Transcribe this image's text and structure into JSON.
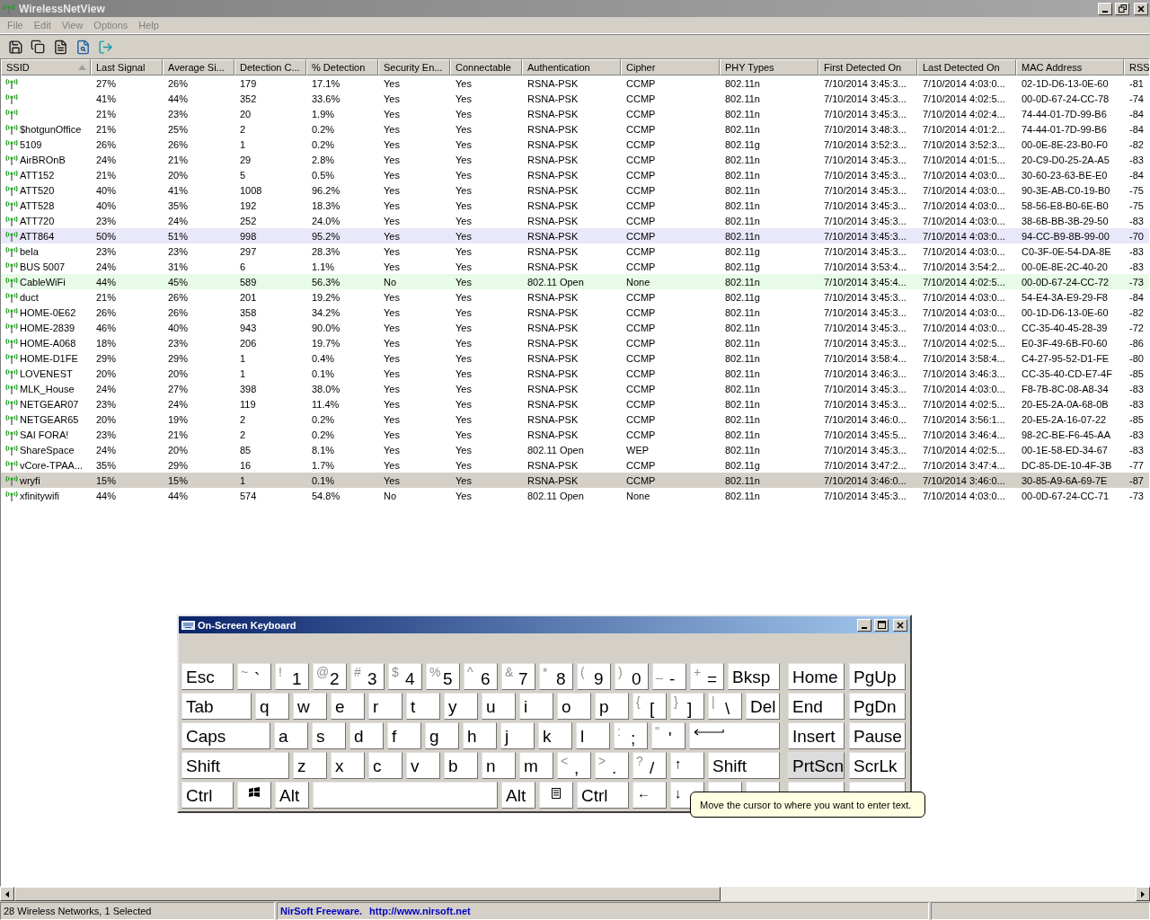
{
  "window": {
    "title": "WirelessNetView"
  },
  "menu": [
    "File",
    "Edit",
    "View",
    "Options",
    "Help"
  ],
  "toolbar": [
    {
      "kind": "save"
    },
    {
      "kind": "copy"
    },
    {
      "kind": "properties"
    },
    {
      "kind": "find"
    },
    {
      "kind": "exit"
    }
  ],
  "table": {
    "columns": [
      {
        "label": "SSID",
        "sorted": true
      },
      {
        "label": "Last Signal",
        "sorted": false
      },
      {
        "label": "Average Si...",
        "sorted": false
      },
      {
        "label": "Detection C...",
        "sorted": false
      },
      {
        "label": "% Detection",
        "sorted": false
      },
      {
        "label": "Security En...",
        "sorted": false
      },
      {
        "label": "Connectable",
        "sorted": false
      },
      {
        "label": "Authentication",
        "sorted": false
      },
      {
        "label": "Cipher",
        "sorted": false
      },
      {
        "label": "PHY Types",
        "sorted": false
      },
      {
        "label": "First Detected On",
        "sorted": false
      },
      {
        "label": "Last Detected On",
        "sorted": false
      },
      {
        "label": "MAC Address",
        "sorted": false
      },
      {
        "label": "RSS",
        "sorted": false
      }
    ],
    "rows": [
      {
        "values": [
          "27%",
          "26%",
          "179",
          "17.1%",
          "Yes",
          "Yes",
          "RSNA-PSK",
          "CCMP",
          "802.11n",
          "7/10/2014 3:45:3...",
          "7/10/2014 4:03:0...",
          "02-1D-D6-13-0E-60",
          "-81"
        ],
        "color": "#ffffff",
        "selected": false
      },
      {
        "values": [
          "41%",
          "44%",
          "352",
          "33.6%",
          "Yes",
          "Yes",
          "RSNA-PSK",
          "CCMP",
          "802.11n",
          "7/10/2014 3:45:3...",
          "7/10/2014 4:02:5...",
          "00-0D-67-24-CC-78",
          "-74"
        ],
        "color": "#ffffff",
        "selected": false
      },
      {
        "values": [
          "21%",
          "23%",
          "20",
          "1.9%",
          "Yes",
          "Yes",
          "RSNA-PSK",
          "CCMP",
          "802.11n",
          "7/10/2014 3:45:3...",
          "7/10/2014 4:02:4...",
          "74-44-01-7D-99-B6",
          "-84"
        ],
        "color": "#ffffff",
        "selected": false
      },
      {
        "ssid": "$hotgunOffice",
        "values": [
          "21%",
          "25%",
          "2",
          "0.2%",
          "Yes",
          "Yes",
          "RSNA-PSK",
          "CCMP",
          "802.11n",
          "7/10/2014 3:48:3...",
          "7/10/2014 4:01:2...",
          "74-44-01-7D-99-B6",
          "-84"
        ],
        "color": "#ffffff",
        "selected": false
      },
      {
        "ssid": "5109",
        "values": [
          "26%",
          "26%",
          "1",
          "0.2%",
          "Yes",
          "Yes",
          "RSNA-PSK",
          "CCMP",
          "802.11g",
          "7/10/2014 3:52:3...",
          "7/10/2014 3:52:3...",
          "00-0E-8E-23-B0-F0",
          "-82"
        ],
        "color": "#ffffff",
        "selected": false
      },
      {
        "ssid": "AirBROnB",
        "values": [
          "24%",
          "21%",
          "29",
          "2.8%",
          "Yes",
          "Yes",
          "RSNA-PSK",
          "CCMP",
          "802.11n",
          "7/10/2014 3:45:3...",
          "7/10/2014 4:01:5...",
          "20-C9-D0-25-2A-A5",
          "-83"
        ],
        "color": "#ffffff",
        "selected": false
      },
      {
        "ssid": "ATT152",
        "values": [
          "21%",
          "20%",
          "5",
          "0.5%",
          "Yes",
          "Yes",
          "RSNA-PSK",
          "CCMP",
          "802.11n",
          "7/10/2014 3:45:3...",
          "7/10/2014 4:03:0...",
          "30-60-23-63-BE-E0",
          "-84"
        ],
        "color": "#ffffff",
        "selected": false
      },
      {
        "ssid": "ATT520",
        "values": [
          "40%",
          "41%",
          "1008",
          "96.2%",
          "Yes",
          "Yes",
          "RSNA-PSK",
          "CCMP",
          "802.11n",
          "7/10/2014 3:45:3...",
          "7/10/2014 4:03:0...",
          "90-3E-AB-C0-19-B0",
          "-75"
        ],
        "color": "#ffffff",
        "selected": false
      },
      {
        "ssid": "ATT528",
        "values": [
          "40%",
          "35%",
          "192",
          "18.3%",
          "Yes",
          "Yes",
          "RSNA-PSK",
          "CCMP",
          "802.11n",
          "7/10/2014 3:45:3...",
          "7/10/2014 4:03:0...",
          "58-56-E8-B0-6E-B0",
          "-75"
        ],
        "color": "#ffffff",
        "selected": false
      },
      {
        "ssid": "ATT720",
        "values": [
          "23%",
          "24%",
          "252",
          "24.0%",
          "Yes",
          "Yes",
          "RSNA-PSK",
          "CCMP",
          "802.11n",
          "7/10/2014 3:45:3...",
          "7/10/2014 4:03:0...",
          "38-6B-BB-3B-29-50",
          "-83"
        ],
        "color": "#ffffff",
        "selected": false
      },
      {
        "ssid": "ATT864",
        "values": [
          "50%",
          "51%",
          "998",
          "95.2%",
          "Yes",
          "Yes",
          "RSNA-PSK",
          "CCMP",
          "802.11n",
          "7/10/2014 3:45:3...",
          "7/10/2014 4:03:0...",
          "94-CC-B9-8B-99-00",
          "-70"
        ],
        "color": "#e8e8fa",
        "selected": false
      },
      {
        "ssid": "bela",
        "values": [
          "23%",
          "23%",
          "297",
          "28.3%",
          "Yes",
          "Yes",
          "RSNA-PSK",
          "CCMP",
          "802.11g",
          "7/10/2014 3:45:3...",
          "7/10/2014 4:03:0...",
          "C0-3F-0E-54-DA-8E",
          "-83"
        ],
        "color": "#ffffff",
        "selected": false
      },
      {
        "ssid": "BUS 5007",
        "values": [
          "24%",
          "31%",
          "6",
          "1.1%",
          "Yes",
          "Yes",
          "RSNA-PSK",
          "CCMP",
          "802.11g",
          "7/10/2014 3:53:4...",
          "7/10/2014 3:54:2...",
          "00-0E-8E-2C-40-20",
          "-83"
        ],
        "color": "#ffffff",
        "selected": false
      },
      {
        "ssid": "CableWiFi",
        "values": [
          "44%",
          "45%",
          "589",
          "56.3%",
          "No",
          "Yes",
          "802.11 Open",
          "None",
          "802.11n",
          "7/10/2014 3:45:4...",
          "7/10/2014 4:02:5...",
          "00-0D-67-24-CC-72",
          "-73"
        ],
        "color": "#e8fae8",
        "selected": false
      },
      {
        "ssid": "duct",
        "values": [
          "21%",
          "26%",
          "201",
          "19.2%",
          "Yes",
          "Yes",
          "RSNA-PSK",
          "CCMP",
          "802.11g",
          "7/10/2014 3:45:3...",
          "7/10/2014 4:03:0...",
          "54-E4-3A-E9-29-F8",
          "-84"
        ],
        "color": "#ffffff",
        "selected": false
      },
      {
        "ssid": "HOME-0E62",
        "values": [
          "26%",
          "26%",
          "358",
          "34.2%",
          "Yes",
          "Yes",
          "RSNA-PSK",
          "CCMP",
          "802.11n",
          "7/10/2014 3:45:3...",
          "7/10/2014 4:03:0...",
          "00-1D-D6-13-0E-60",
          "-82"
        ],
        "color": "#ffffff",
        "selected": false
      },
      {
        "ssid": "HOME-2839",
        "values": [
          "46%",
          "40%",
          "943",
          "90.0%",
          "Yes",
          "Yes",
          "RSNA-PSK",
          "CCMP",
          "802.11n",
          "7/10/2014 3:45:3...",
          "7/10/2014 4:03:0...",
          "CC-35-40-45-28-39",
          "-72"
        ],
        "color": "#ffffff",
        "selected": false
      },
      {
        "ssid": "HOME-A068",
        "values": [
          "18%",
          "23%",
          "206",
          "19.7%",
          "Yes",
          "Yes",
          "RSNA-PSK",
          "CCMP",
          "802.11n",
          "7/10/2014 3:45:3...",
          "7/10/2014 4:02:5...",
          "E0-3F-49-6B-F0-60",
          "-86"
        ],
        "color": "#ffffff",
        "selected": false
      },
      {
        "ssid": "HOME-D1FE",
        "values": [
          "29%",
          "29%",
          "1",
          "0.4%",
          "Yes",
          "Yes",
          "RSNA-PSK",
          "CCMP",
          "802.11n",
          "7/10/2014 3:58:4...",
          "7/10/2014 3:58:4...",
          "C4-27-95-52-D1-FE",
          "-80"
        ],
        "color": "#ffffff",
        "selected": false
      },
      {
        "ssid": "LOVENEST",
        "values": [
          "20%",
          "20%",
          "1",
          "0.1%",
          "Yes",
          "Yes",
          "RSNA-PSK",
          "CCMP",
          "802.11n",
          "7/10/2014 3:46:3...",
          "7/10/2014 3:46:3...",
          "CC-35-40-CD-E7-4F",
          "-85"
        ],
        "color": "#ffffff",
        "selected": false
      },
      {
        "ssid": "MLK_House",
        "values": [
          "24%",
          "27%",
          "398",
          "38.0%",
          "Yes",
          "Yes",
          "RSNA-PSK",
          "CCMP",
          "802.11n",
          "7/10/2014 3:45:3...",
          "7/10/2014 4:03:0...",
          "F8-7B-8C-08-A8-34",
          "-83"
        ],
        "color": "#ffffff",
        "selected": false
      },
      {
        "ssid": "NETGEAR07",
        "values": [
          "23%",
          "24%",
          "119",
          "11.4%",
          "Yes",
          "Yes",
          "RSNA-PSK",
          "CCMP",
          "802.11n",
          "7/10/2014 3:45:3...",
          "7/10/2014 4:02:5...",
          "20-E5-2A-0A-68-0B",
          "-83"
        ],
        "color": "#ffffff",
        "selected": false
      },
      {
        "ssid": "NETGEAR65",
        "values": [
          "20%",
          "19%",
          "2",
          "0.2%",
          "Yes",
          "Yes",
          "RSNA-PSK",
          "CCMP",
          "802.11n",
          "7/10/2014 3:46:0...",
          "7/10/2014 3:56:1...",
          "20-E5-2A-16-07-22",
          "-85"
        ],
        "color": "#ffffff",
        "selected": false
      },
      {
        "ssid": "SAI FORA!",
        "values": [
          "23%",
          "21%",
          "2",
          "0.2%",
          "Yes",
          "Yes",
          "RSNA-PSK",
          "CCMP",
          "802.11n",
          "7/10/2014 3:45:5...",
          "7/10/2014 3:46:4...",
          "98-2C-BE-F6-45-AA",
          "-83"
        ],
        "color": "#ffffff",
        "selected": false
      },
      {
        "ssid": "ShareSpace",
        "values": [
          "24%",
          "20%",
          "85",
          "8.1%",
          "Yes",
          "Yes",
          "802.11 Open",
          "WEP",
          "802.11n",
          "7/10/2014 3:45:3...",
          "7/10/2014 4:02:5...",
          "00-1E-58-ED-34-67",
          "-83"
        ],
        "color": "#ffffff",
        "selected": false
      },
      {
        "ssid": "vCore-TPAA...",
        "values": [
          "35%",
          "29%",
          "16",
          "1.7%",
          "Yes",
          "Yes",
          "RSNA-PSK",
          "CCMP",
          "802.11g",
          "7/10/2014 3:47:2...",
          "7/10/2014 3:47:4...",
          "DC-85-DE-10-4F-3B",
          "-77"
        ],
        "color": "#ffffff",
        "selected": false
      },
      {
        "ssid": "wryfi",
        "values": [
          "15%",
          "15%",
          "1",
          "0.1%",
          "Yes",
          "Yes",
          "RSNA-PSK",
          "CCMP",
          "802.11n",
          "7/10/2014 3:46:0...",
          "7/10/2014 3:46:0...",
          "30-85-A9-6A-69-7E",
          "-87"
        ],
        "selected": true
      },
      {
        "ssid": "xfinitywifi",
        "values": [
          "44%",
          "44%",
          "574",
          "54.8%",
          "No",
          "Yes",
          "802.11 Open",
          "None",
          "802.11n",
          "7/10/2014 3:45:3...",
          "7/10/2014 4:03:0...",
          "00-0D-67-24-CC-71",
          "-73"
        ],
        "color": "#ffffff",
        "selected": false
      }
    ]
  },
  "keyboard": {
    "title": "On-Screen Keyboard",
    "tooltip": "Move the cursor to where you want to enter text.",
    "rows": [
      {
        "main": [
          {
            "kind": "text",
            "label": "Esc",
            "pressed": false
          },
          {
            "kind": "dual",
            "shifted": "~",
            "label": "`",
            "pressed": false
          },
          {
            "kind": "dual",
            "shifted": "!",
            "label": "1",
            "pressed": false
          },
          {
            "kind": "dual",
            "shifted": "@",
            "label": "2",
            "pressed": false
          },
          {
            "kind": "dual",
            "shifted": "#",
            "label": "3",
            "pressed": false
          },
          {
            "kind": "dual",
            "shifted": "$",
            "label": "4",
            "pressed": false
          },
          {
            "kind": "dual",
            "shifted": "%",
            "label": "5",
            "pressed": false
          },
          {
            "kind": "dual",
            "shifted": "^",
            "label": "6",
            "pressed": false
          },
          {
            "kind": "dual",
            "shifted": "&",
            "label": "7",
            "pressed": false
          },
          {
            "kind": "dual",
            "shifted": "*",
            "label": "8",
            "pressed": false
          },
          {
            "kind": "dual",
            "shifted": "(",
            "label": "9",
            "pressed": false
          },
          {
            "kind": "dual",
            "shifted": ")",
            "label": "0",
            "pressed": false
          },
          {
            "kind": "dual",
            "shifted": "_",
            "label": "-",
            "pressed": false
          },
          {
            "kind": "dual",
            "shifted": "+",
            "label": "=",
            "pressed": false
          },
          {
            "kind": "text",
            "label": "Bksp",
            "pressed": false
          }
        ],
        "nav": [
          {
            "kind": "text",
            "label": "Home",
            "pressed": false
          },
          {
            "kind": "text",
            "label": "PgUp",
            "pressed": false
          }
        ]
      },
      {
        "main": [
          {
            "kind": "text",
            "label": "Tab",
            "pressed": false
          },
          {
            "kind": "text",
            "label": "q",
            "pressed": false
          },
          {
            "kind": "text",
            "label": "w",
            "pressed": false
          },
          {
            "kind": "text",
            "label": "e",
            "pressed": false
          },
          {
            "kind": "text",
            "label": "r",
            "pressed": false
          },
          {
            "kind": "text",
            "label": "t",
            "pressed": false
          },
          {
            "kind": "text",
            "label": "y",
            "pressed": false
          },
          {
            "kind": "text",
            "label": "u",
            "pressed": false
          },
          {
            "kind": "text",
            "label": "i",
            "pressed": false
          },
          {
            "kind": "text",
            "label": "o",
            "pressed": false
          },
          {
            "kind": "text",
            "label": "p",
            "pressed": false
          },
          {
            "kind": "dual",
            "shifted": "{",
            "label": "[",
            "pressed": false
          },
          {
            "kind": "dual",
            "shifted": "}",
            "label": "]",
            "pressed": false
          },
          {
            "kind": "dual",
            "shifted": "|",
            "label": "\\",
            "pressed": false
          },
          {
            "kind": "text",
            "label": "Del",
            "pressed": false
          }
        ],
        "nav": [
          {
            "kind": "text",
            "label": "End",
            "pressed": false
          },
          {
            "kind": "text",
            "label": "PgDn",
            "pressed": false
          }
        ]
      },
      {
        "main": [
          {
            "kind": "text",
            "label": "Caps",
            "pressed": false
          },
          {
            "kind": "text",
            "label": "a",
            "pressed": false
          },
          {
            "kind": "text",
            "label": "s",
            "pressed": false
          },
          {
            "kind": "text",
            "label": "d",
            "pressed": false
          },
          {
            "kind": "text",
            "label": "f",
            "pressed": false
          },
          {
            "kind": "text",
            "label": "g",
            "pressed": false
          },
          {
            "kind": "text",
            "label": "h",
            "pressed": false
          },
          {
            "kind": "text",
            "label": "j",
            "pressed": false
          },
          {
            "kind": "text",
            "label": "k",
            "pressed": false
          },
          {
            "kind": "text",
            "label": "l",
            "pressed": false
          },
          {
            "kind": "dual",
            "shifted": ":",
            "label": ";",
            "pressed": false
          },
          {
            "kind": "dual",
            "shifted": "\"",
            "label": "'",
            "pressed": false
          },
          {
            "kind": "enter",
            "pressed": false
          }
        ],
        "nav": [
          {
            "kind": "text",
            "label": "Insert",
            "pressed": false
          },
          {
            "kind": "text",
            "label": "Pause",
            "pressed": false
          }
        ]
      },
      {
        "main": [
          {
            "kind": "text",
            "label": "Shift",
            "pressed": false
          },
          {
            "kind": "text",
            "label": "z",
            "pressed": false
          },
          {
            "kind": "text",
            "label": "x",
            "pressed": false
          },
          {
            "kind": "text",
            "label": "c",
            "pressed": false
          },
          {
            "kind": "text",
            "label": "v",
            "pressed": false
          },
          {
            "kind": "text",
            "label": "b",
            "pressed": false
          },
          {
            "kind": "text",
            "label": "n",
            "pressed": false
          },
          {
            "kind": "text",
            "label": "m",
            "pressed": false
          },
          {
            "kind": "dual",
            "shifted": "<",
            "label": ",",
            "pressed": false
          },
          {
            "kind": "dual",
            "shifted": ">",
            "label": ".",
            "pressed": false
          },
          {
            "kind": "dual",
            "shifted": "?",
            "label": "/",
            "pressed": false
          },
          {
            "kind": "arrow",
            "label": "↑",
            "pressed": false
          },
          {
            "kind": "text",
            "label": "Shift",
            "pressed": false
          }
        ],
        "nav": [
          {
            "kind": "text",
            "label": "PrtScn",
            "pressed": true
          },
          {
            "kind": "text",
            "label": "ScrLk",
            "pressed": false
          }
        ]
      },
      {
        "main": [
          {
            "kind": "text",
            "label": "Ctrl",
            "pressed": false
          },
          {
            "kind": "windows",
            "pressed": false
          },
          {
            "kind": "text",
            "label": "Alt",
            "pressed": false
          },
          {
            "kind": "space",
            "pressed": false
          },
          {
            "kind": "text",
            "label": "Alt",
            "pressed": false
          },
          {
            "kind": "menu",
            "pressed": false
          },
          {
            "kind": "text",
            "label": "Ctrl",
            "pressed": false
          },
          {
            "kind": "arrow",
            "label": "←",
            "pressed": false
          },
          {
            "kind": "arrow",
            "label": "↓",
            "pressed": false
          },
          {
            "kind": "covered",
            "pressed": false
          },
          {
            "kind": "covered",
            "pressed": false
          }
        ],
        "nav": [
          {
            "kind": "covered",
            "pressed": false
          },
          {
            "kind": "covered",
            "pressed": false
          }
        ]
      }
    ]
  },
  "status_bar": {
    "count": "28 Wireless Networks, 1 Selected",
    "credit": "NirSoft Freeware.",
    "link": "http://www.nirsoft.net"
  }
}
